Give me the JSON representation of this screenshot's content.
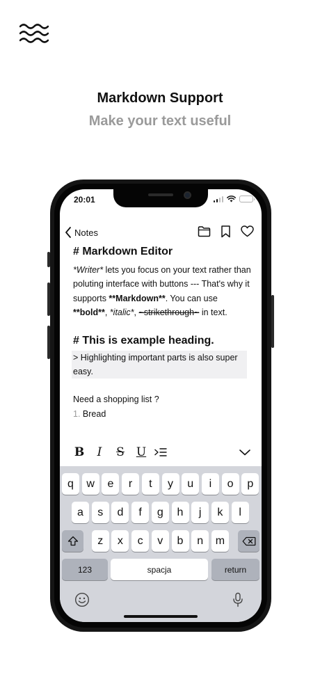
{
  "promo": {
    "logo_icon": "waves-icon",
    "title": "Markdown Support",
    "subtitle": "Make your text useful"
  },
  "status_bar": {
    "time": "20:01",
    "icons": [
      "signal-icon",
      "wifi-icon",
      "battery-icon"
    ],
    "battery_color": "#f5c518"
  },
  "nav": {
    "back_label": "Notes",
    "back_icon": "chevron-left-icon",
    "actions": [
      "folder-icon",
      "bookmark-icon",
      "heart-icon"
    ]
  },
  "editor": {
    "heading1": "# Markdown Editor",
    "para1": {
      "writer": "*Writer*",
      "text_a": " lets you focus on your text rather than poluting interface with buttons --- That's why it supports ",
      "markdown": "**Markdown**",
      "text_b": ". You can use ",
      "bold": "**bold**",
      "comma1": ", ",
      "italic": "*italic*",
      "comma2": ",",
      "strike": "~strikethrough~",
      "text_c": " in text."
    },
    "heading2": "# This is example heading.",
    "quote": "> Highlighting important parts is also super easy.",
    "list_intro": "Need a shopping list ?",
    "list_items": [
      {
        "num": "1.",
        "text": "Bread"
      }
    ]
  },
  "toolbar": {
    "bold": "B",
    "italic": "I",
    "strike": "S",
    "underline": "U",
    "icons": [
      "bold-icon",
      "italic-icon",
      "strikethrough-icon",
      "underline-icon",
      "quote-list-icon",
      "chevron-down-icon"
    ]
  },
  "keyboard": {
    "row1": [
      "q",
      "w",
      "e",
      "r",
      "t",
      "y",
      "u",
      "i",
      "o",
      "p"
    ],
    "row2": [
      "a",
      "s",
      "d",
      "f",
      "g",
      "h",
      "j",
      "k",
      "l"
    ],
    "row3": [
      "z",
      "x",
      "c",
      "v",
      "b",
      "n",
      "m"
    ],
    "numbers_key": "123",
    "space_key": "spacja",
    "return_key": "return",
    "icons": [
      "shift-icon",
      "backspace-icon",
      "emoji-icon",
      "microphone-icon"
    ]
  }
}
